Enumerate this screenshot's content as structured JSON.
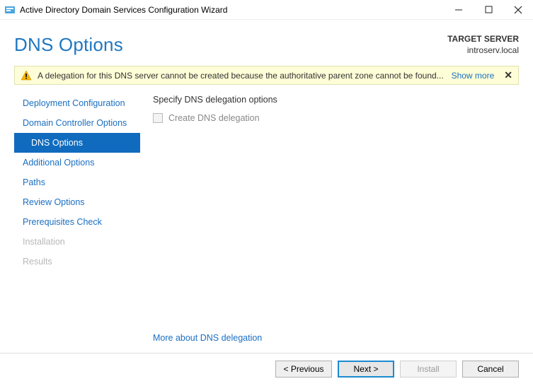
{
  "window": {
    "title": "Active Directory Domain Services Configuration Wizard"
  },
  "header": {
    "page_title": "DNS Options",
    "target_label": "TARGET SERVER",
    "target_value": "introserv.local"
  },
  "warning": {
    "text": "A delegation for this DNS server cannot be created because the authoritative parent zone cannot be found...",
    "show_more": "Show more"
  },
  "sidebar": {
    "items": [
      {
        "label": "Deployment Configuration",
        "state": "normal"
      },
      {
        "label": "Domain Controller Options",
        "state": "normal"
      },
      {
        "label": "DNS Options",
        "state": "selected"
      },
      {
        "label": "Additional Options",
        "state": "normal"
      },
      {
        "label": "Paths",
        "state": "normal"
      },
      {
        "label": "Review Options",
        "state": "normal"
      },
      {
        "label": "Prerequisites Check",
        "state": "normal"
      },
      {
        "label": "Installation",
        "state": "disabled"
      },
      {
        "label": "Results",
        "state": "disabled"
      }
    ]
  },
  "content": {
    "specify": "Specify DNS delegation options",
    "checkbox_label": "Create DNS delegation",
    "more_link": "More about DNS delegation"
  },
  "footer": {
    "previous": "< Previous",
    "next": "Next >",
    "install": "Install",
    "cancel": "Cancel"
  }
}
